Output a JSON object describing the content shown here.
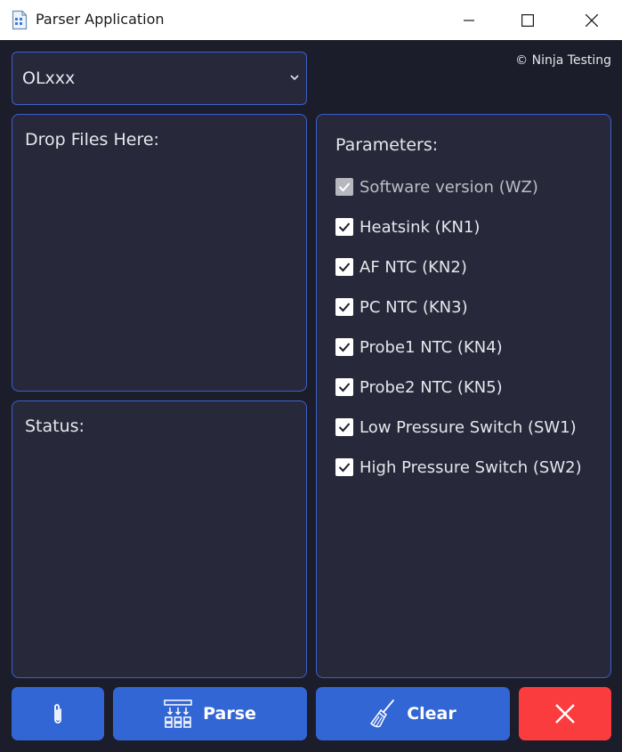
{
  "window": {
    "title": "Parser Application",
    "min_icon": "minimize-icon",
    "max_icon": "maximize-icon",
    "close_icon": "close-icon"
  },
  "model_select": {
    "value": "OLxxx",
    "options": [
      "OLxxx"
    ]
  },
  "copyright": "© Ninja Testing",
  "drop_panel": {
    "label": "Drop Files Here:"
  },
  "status_panel": {
    "label": "Status:"
  },
  "parameters": {
    "title": "Parameters:",
    "items": [
      {
        "label": "Software version (WZ)",
        "checked": true,
        "disabled": true
      },
      {
        "label": "Heatsink (KN1)",
        "checked": true,
        "disabled": false
      },
      {
        "label": "AF NTC (KN2)",
        "checked": true,
        "disabled": false
      },
      {
        "label": "PC NTC (KN3)",
        "checked": true,
        "disabled": false
      },
      {
        "label": "Probe1 NTC (KN4)",
        "checked": true,
        "disabled": false
      },
      {
        "label": "Probe2 NTC (KN5)",
        "checked": true,
        "disabled": false
      },
      {
        "label": "Low Pressure Switch (SW1)",
        "checked": true,
        "disabled": false
      },
      {
        "label": "High Pressure Switch (SW2)",
        "checked": true,
        "disabled": false
      }
    ]
  },
  "buttons": {
    "attach_icon": "paperclip-icon",
    "parse_label": "Parse",
    "parse_icon": "parse-icon",
    "clear_label": "Clear",
    "clear_icon": "broom-icon",
    "exit_icon": "close-icon"
  },
  "colors": {
    "background": "#1c1d2a",
    "panel": "#272839",
    "border": "#3c5fcd",
    "button_blue": "#3266d4",
    "button_red": "#fb3c3f"
  }
}
